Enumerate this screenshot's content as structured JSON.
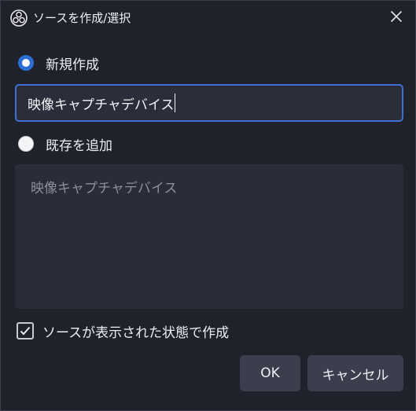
{
  "window": {
    "title": "ソースを作成/選択",
    "app_icon": "obs-logo-icon",
    "close_icon": "close-icon"
  },
  "create_new": {
    "label": "新規作成",
    "selected": true
  },
  "name_input": {
    "value": "映像キャプチャデバイス"
  },
  "add_existing": {
    "label": "既存を追加",
    "selected": false,
    "items": [
      "映像キャプチャデバイス"
    ]
  },
  "visible_checkbox": {
    "label": "ソースが表示された状態で作成",
    "checked": true
  },
  "buttons": {
    "ok": "OK",
    "cancel": "キャンセル"
  },
  "colors": {
    "background": "#1f212b",
    "accent": "#2b6fd6",
    "button": "#3b3e4c",
    "list_background": "#2a2c37"
  }
}
